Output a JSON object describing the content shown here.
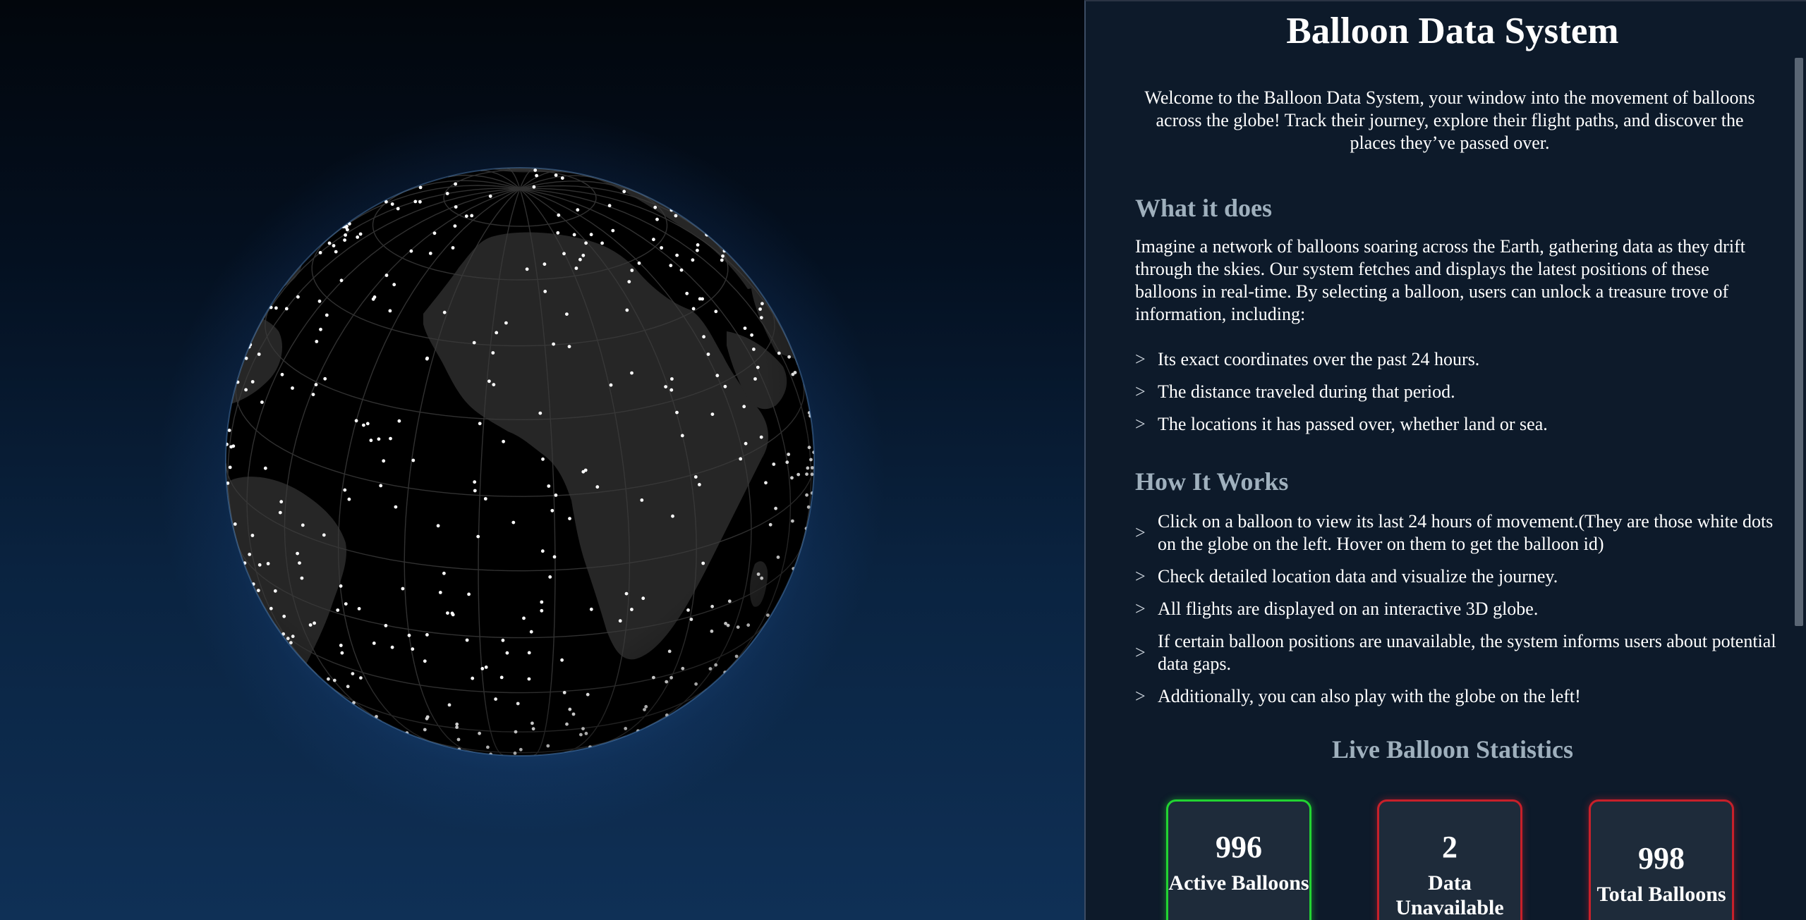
{
  "globe": {
    "ocean_color": "#000000",
    "land_color": "#262626",
    "grid_color": "#3a3a3a",
    "atmosphere_color": "#4a8fe0",
    "balloon_marker_color": "#ffffff",
    "balloon_marker_icon": "white-dot"
  },
  "panel": {
    "title": "Balloon Data System",
    "welcome": "Welcome to the Balloon Data System, your window into the movement of balloons across the globe! Track their journey, explore their flight paths, and discover the places they’ve passed over.",
    "what_heading": "What it does",
    "what_intro": "Imagine a network of balloons soaring across the Earth, gathering data as they drift through the skies. Our system fetches and displays the latest positions of these balloons in real-time. By selecting a balloon, users can unlock a treasure trove of information, including:",
    "bullet_glyph": ">",
    "what_items": [
      "Its exact coordinates over the past 24 hours.",
      "The distance traveled during that period.",
      "The locations it has passed over, whether land or sea."
    ],
    "how_heading": "How It Works",
    "how_items": [
      "Click on a balloon to view its last 24 hours of movement.(They are those white dots on the globe on the left. Hover on them to get the balloon id)",
      "Check detailed location data and visualize the journey.",
      "All flights are displayed on an interactive 3D globe.",
      "If certain balloon positions are unavailable, the system informs users about potential data gaps.",
      "Additionally, you can also play with the globe on the left!"
    ],
    "stats_heading": "Live Balloon Statistics",
    "stats": [
      {
        "value": "996",
        "label": "Active Balloons",
        "status_color": "#22d432"
      },
      {
        "value": "2",
        "label": "Data Unavailable",
        "status_color": "#c8202a"
      },
      {
        "value": "998",
        "label": "Total Balloons",
        "status_color": "#c8202a"
      }
    ]
  }
}
